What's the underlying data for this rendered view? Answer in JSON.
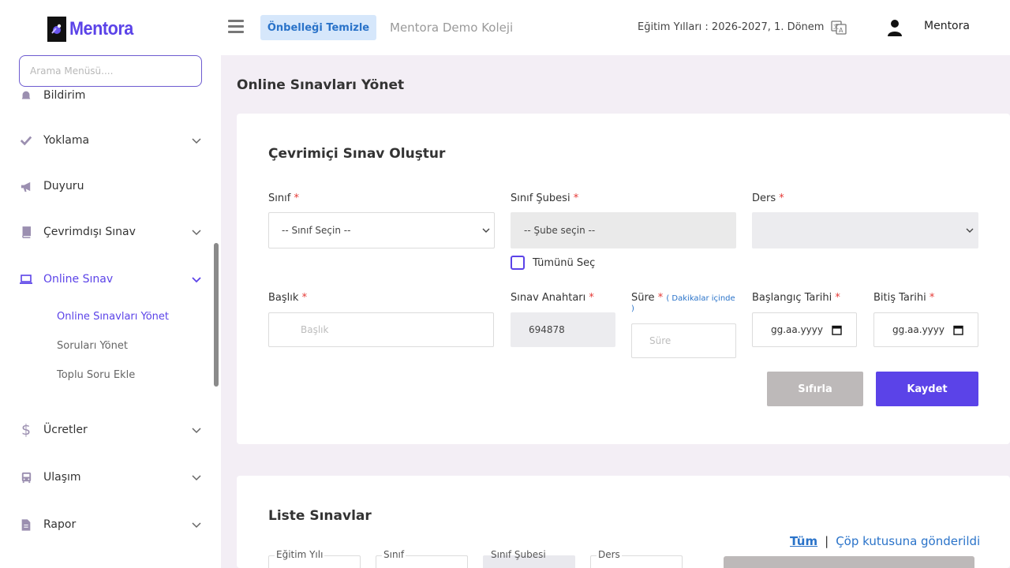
{
  "header": {
    "logo_text": "Mentora",
    "cache_button": "Önbelleği Temizle",
    "school_name": "Mentora Demo Koleji",
    "education_year": "Eğitim Yılları : 2026-2027, 1. Dönem",
    "user_name": "Mentora"
  },
  "sidebar": {
    "search_placeholder": "Arama Menüsü....",
    "items": [
      {
        "label": "Bildirim",
        "icon": "bell-icon"
      },
      {
        "label": "Yoklama",
        "icon": "check-icon"
      },
      {
        "label": "Duyuru",
        "icon": "megaphone-icon"
      },
      {
        "label": "Çevrimdışı Sınav",
        "icon": "book-icon"
      },
      {
        "label": "Online Sınav",
        "icon": "laptop-icon"
      },
      {
        "label": "Ücretler",
        "icon": "dollar-icon"
      },
      {
        "label": "Ulaşım",
        "icon": "bus-icon"
      },
      {
        "label": "Rapor",
        "icon": "document-icon"
      }
    ],
    "sub_items": [
      {
        "label": "Online Sınavları Yönet",
        "active": true
      },
      {
        "label": "Soruları Yönet",
        "active": false
      },
      {
        "label": "Toplu Soru Ekle",
        "active": false
      }
    ]
  },
  "page": {
    "title": "Online Sınavları Yönet"
  },
  "create_form": {
    "title": "Çevrimiçi Sınav Oluştur",
    "required_mark": "*",
    "class_label": "Sınıf",
    "class_value": "-- Sınıf Seçin --",
    "section_label": "Sınıf Şubesi",
    "section_value": "-- Şube seçin --",
    "subject_label": "Ders",
    "subject_value": "",
    "select_all_label": "Tümünü Seç",
    "title_label": "Başlık",
    "title_placeholder": "Başlık",
    "exam_key_label": "Sınav Anahtarı",
    "exam_key_value": "694878",
    "duration_label": "Süre",
    "duration_hint_line1": "( Dakikalar içinde",
    "duration_hint_line2": ")",
    "duration_placeholder": "Süre",
    "start_date_label": "Başlangıç Tarihi",
    "start_date_value": "gg.aa.yyyy",
    "end_date_label": "Bitiş Tarihi",
    "end_date_value": "gg.aa.yyyy",
    "reset_button": "Sıfırla",
    "save_button": "Kaydet"
  },
  "list": {
    "title": "Liste Sınavlar",
    "link_all": "Tüm",
    "link_separator": "|",
    "link_trash": "Çöp kutusuna gönderildi",
    "filter_year_label": "Eğitim Yılı",
    "filter_class_label": "Sınıf",
    "filter_section_label": "Sınıf Şubesi",
    "filter_subject_label": "Ders"
  },
  "colors": {
    "accent": "#5b43e8",
    "link": "#2a73c9",
    "required": "#e53935",
    "page_bg": "#f3eef5"
  }
}
